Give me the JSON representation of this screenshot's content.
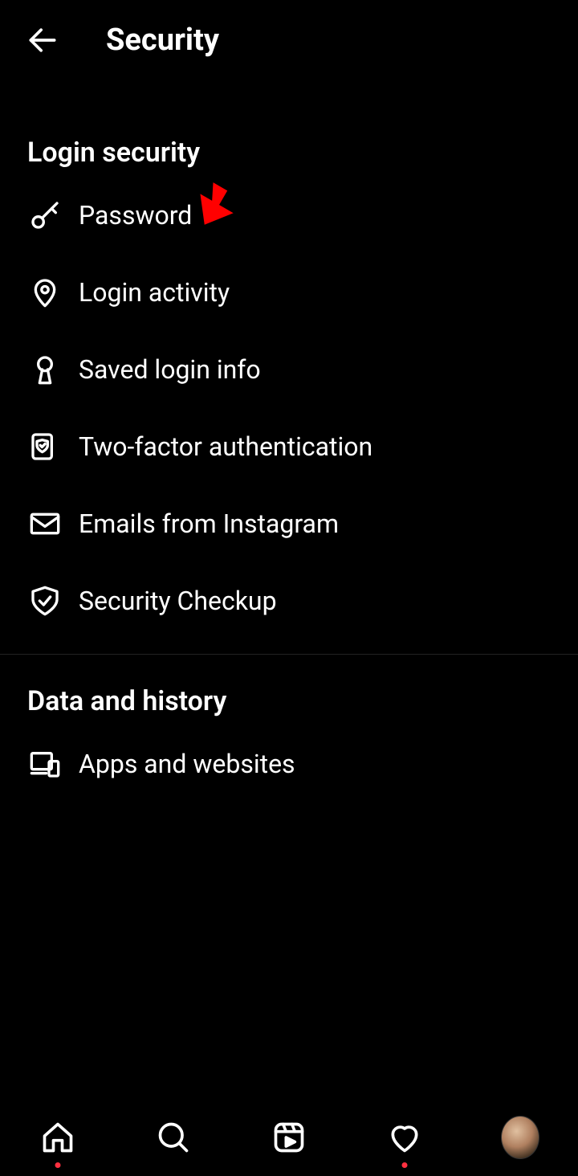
{
  "header": {
    "title": "Security"
  },
  "sections": {
    "login_security": {
      "header": "Login security",
      "items": [
        {
          "label": "Password"
        },
        {
          "label": "Login activity"
        },
        {
          "label": "Saved login info"
        },
        {
          "label": "Two-factor authentication"
        },
        {
          "label": "Emails from Instagram"
        },
        {
          "label": "Security Checkup"
        }
      ]
    },
    "data_and_history": {
      "header": "Data and history",
      "items": [
        {
          "label": "Apps and websites"
        }
      ]
    }
  }
}
